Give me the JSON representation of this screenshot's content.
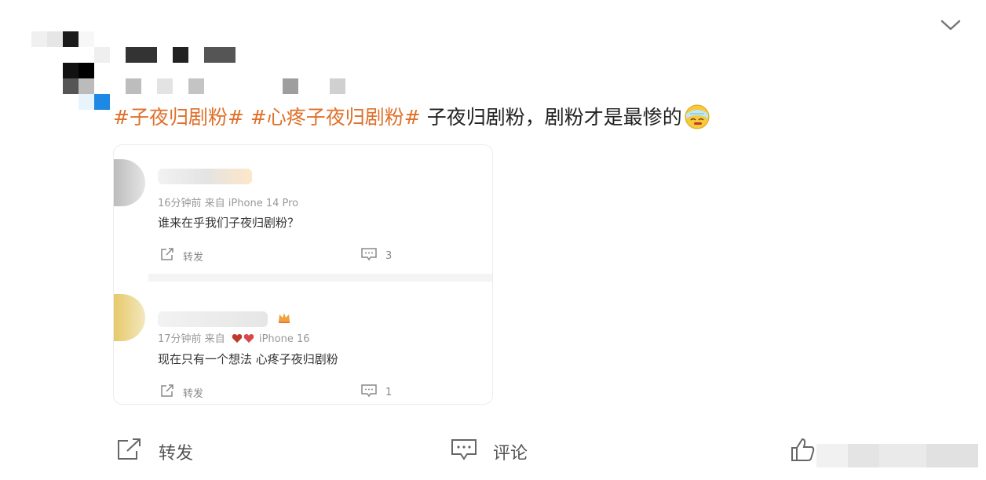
{
  "header": {
    "collapse_icon": "chevron-down-icon"
  },
  "post": {
    "tag1": "#子夜归剧粉#",
    "tag2": "#心疼子夜归剧粉#",
    "text": " 子夜归剧粉，剧粉才是最惨的",
    "emoji": "sick-face-emoji"
  },
  "card": {
    "comments": [
      {
        "meta": "16分钟前  来自 iPhone 14 Pro",
        "text": "谁来在乎我们子夜归剧粉？",
        "repost_label": "转发",
        "comment_count": "3"
      },
      {
        "meta_time": "17分钟前  来自",
        "meta_device": "iPhone 16",
        "text": "现在只有一个想法 心疼子夜归剧粉",
        "repost_label": "转发",
        "comment_count": "1"
      }
    ]
  },
  "actions": {
    "repost": "转发",
    "comment": "评论"
  },
  "colors": {
    "accent": "#e0702a",
    "muted": "#999999"
  }
}
